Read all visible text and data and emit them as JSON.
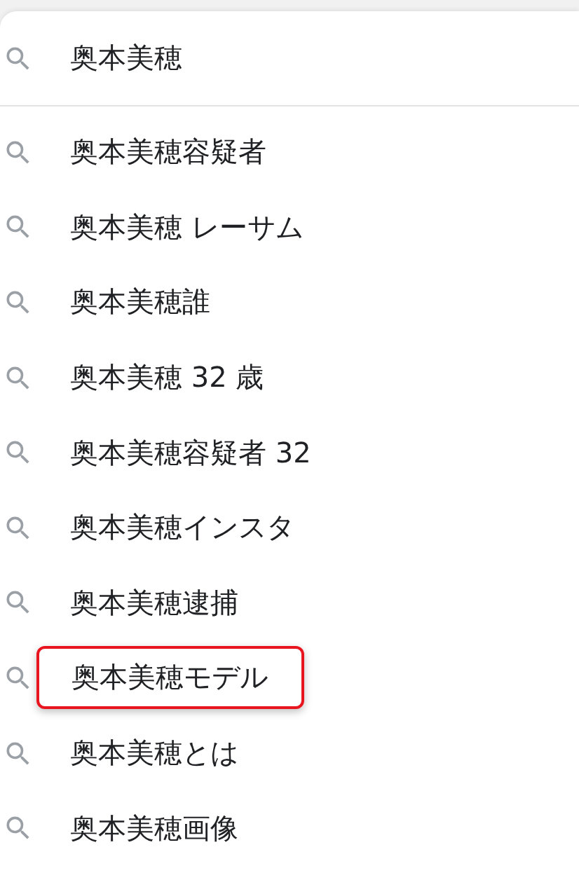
{
  "search": {
    "value": "奥本美穂"
  },
  "suggestions": [
    {
      "text": "奥本美穂容疑者",
      "highlighted": false
    },
    {
      "text": "奥本美穂 レーサム",
      "highlighted": false
    },
    {
      "text": "奥本美穂誰",
      "highlighted": false
    },
    {
      "text": "奥本美穂 32 歳",
      "highlighted": false
    },
    {
      "text": "奥本美穂容疑者 32",
      "highlighted": false
    },
    {
      "text": "奥本美穂インスタ",
      "highlighted": false
    },
    {
      "text": "奥本美穂逮捕",
      "highlighted": false
    },
    {
      "text": "奥本美穂モデル",
      "highlighted": true
    },
    {
      "text": "奥本美穂とは",
      "highlighted": false
    },
    {
      "text": "奥本美穂画像",
      "highlighted": false
    }
  ]
}
